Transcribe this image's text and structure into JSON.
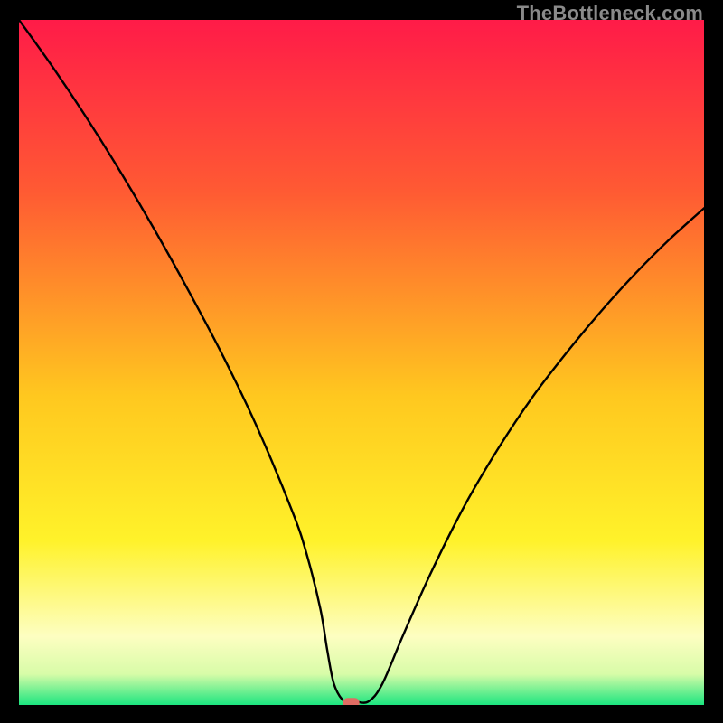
{
  "watermark": "TheBottleneck.com",
  "chart_data": {
    "type": "line",
    "title": "",
    "xlabel": "",
    "ylabel": "",
    "xlim": [
      0,
      100
    ],
    "ylim": [
      0,
      100
    ],
    "gradient_stops": [
      {
        "offset": 0.0,
        "color": "#ff1b48"
      },
      {
        "offset": 0.25,
        "color": "#ff5a33"
      },
      {
        "offset": 0.55,
        "color": "#ffc81f"
      },
      {
        "offset": 0.76,
        "color": "#fff22a"
      },
      {
        "offset": 0.9,
        "color": "#fdfec1"
      },
      {
        "offset": 0.955,
        "color": "#d8fca8"
      },
      {
        "offset": 1.0,
        "color": "#1be57f"
      }
    ],
    "series": [
      {
        "name": "bottleneck-curve",
        "type": "line",
        "x": [
          0,
          5,
          10,
          15,
          20,
          25,
          30,
          35,
          40,
          42,
          44,
          45,
          46,
          47.5,
          49,
          51,
          53,
          56,
          60,
          65,
          70,
          75,
          80,
          85,
          90,
          95,
          100
        ],
        "y": [
          100,
          93,
          85.5,
          77.5,
          69,
          60,
          50.5,
          40,
          28,
          22,
          14,
          8,
          3,
          0.5,
          0.5,
          0.5,
          3,
          10,
          19,
          29,
          37.5,
          45,
          51.5,
          57.5,
          63,
          68,
          72.5
        ]
      }
    ],
    "marker": {
      "x": 48.5,
      "y": 0.3,
      "color": "#e06c63"
    }
  }
}
